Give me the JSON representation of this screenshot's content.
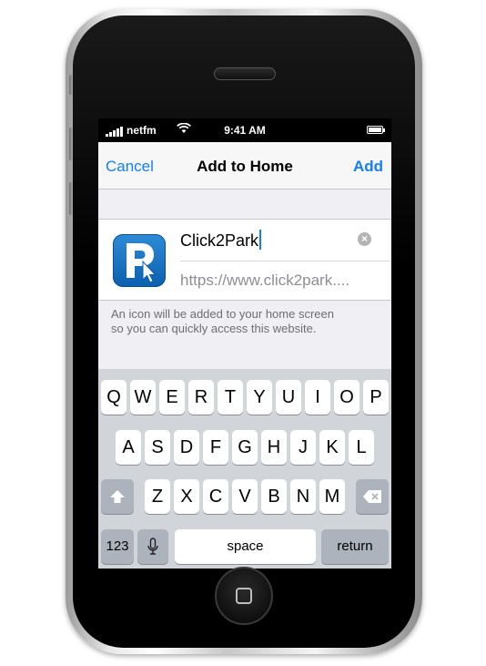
{
  "status_bar": {
    "carrier": "netfm",
    "time": "9:41 AM"
  },
  "nav": {
    "cancel": "Cancel",
    "title": "Add to Home",
    "add": "Add"
  },
  "form": {
    "name": "Click2Park",
    "url": "https://www.click2park....",
    "clear_glyph": "×"
  },
  "helper_text": {
    "line1": "An icon will be added to your home screen",
    "line2": "so you can quickly access this website."
  },
  "keyboard": {
    "row1": [
      "Q",
      "W",
      "E",
      "R",
      "T",
      "Y",
      "U",
      "I",
      "O",
      "P"
    ],
    "row2": [
      "A",
      "S",
      "D",
      "F",
      "G",
      "H",
      "J",
      "K",
      "L"
    ],
    "row3": [
      "Z",
      "X",
      "C",
      "V",
      "B",
      "N",
      "M"
    ],
    "numbers": "123",
    "space": "space",
    "return": "return"
  },
  "colors": {
    "accent": "#147efb",
    "screen_bg": "#efeff4",
    "keyboard_bg": "#d1d4d9"
  },
  "icons": [
    "signal-icon",
    "wifi-icon",
    "battery-icon",
    "app-icon",
    "clear-icon",
    "shift-icon",
    "backspace-icon",
    "microphone-icon",
    "home-button-icon"
  ]
}
